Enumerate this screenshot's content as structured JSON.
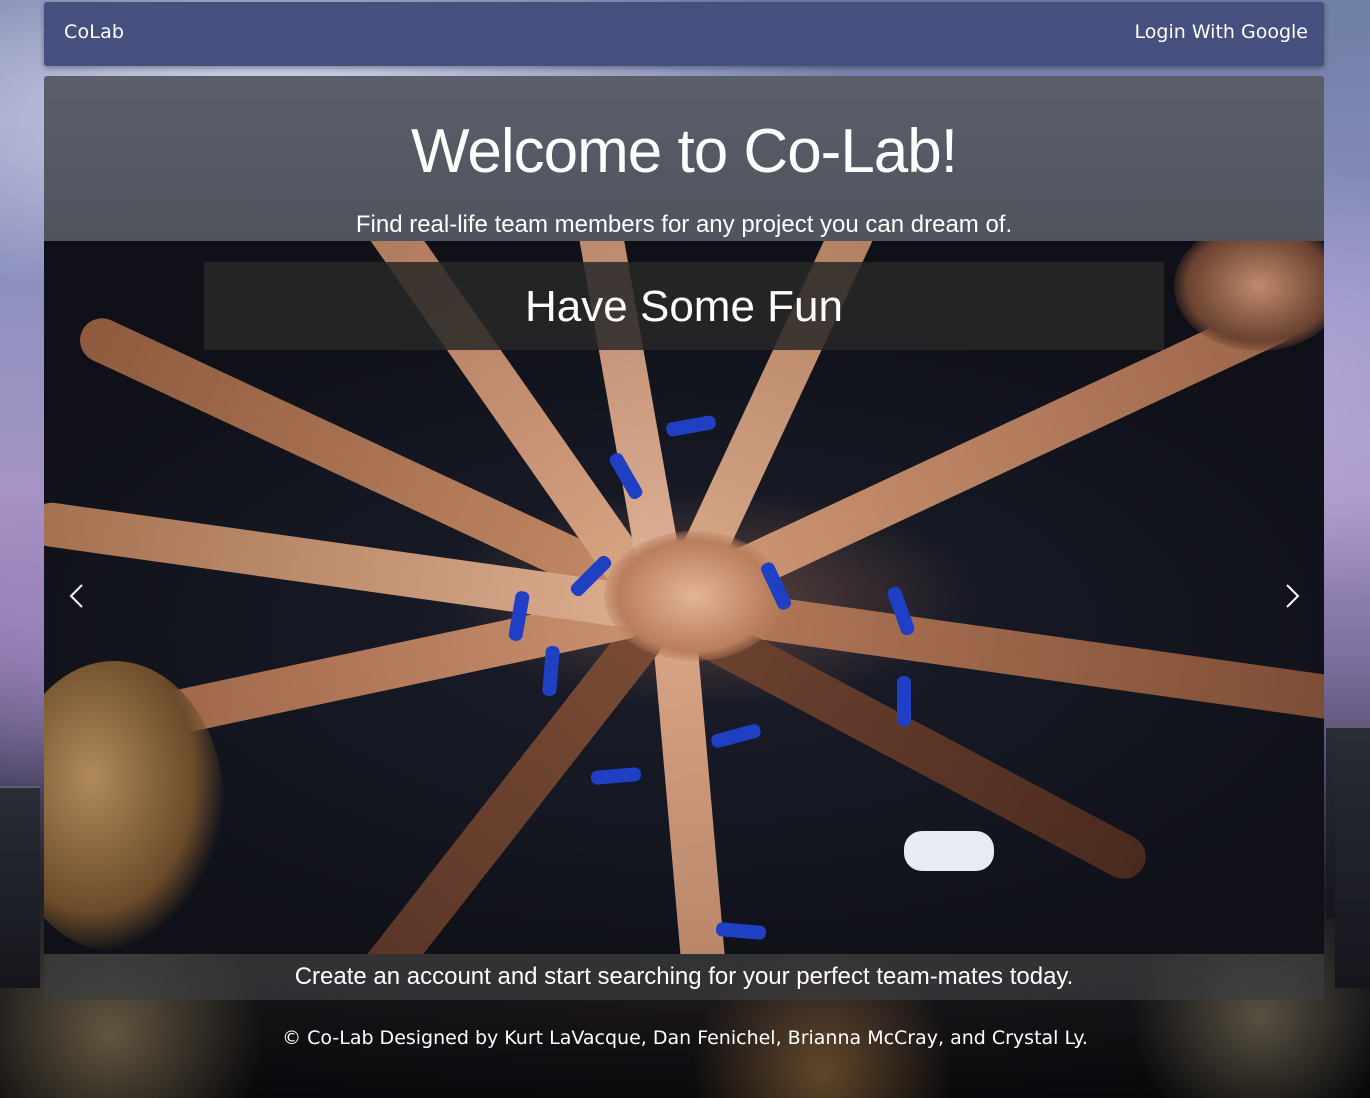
{
  "navbar": {
    "brand": "CoLab",
    "login_label": "Login With Google"
  },
  "jumbotron": {
    "title": "Welcome to Co-Lab!",
    "subtitle": "Find real-life team members for any project you can dream of."
  },
  "carousel": {
    "caption": "Have Some Fun",
    "prev_icon": "chevron-left-icon",
    "next_icon": "chevron-right-icon"
  },
  "cta": {
    "text": "Create an account and start searching for your perfect team-mates today."
  },
  "footer": {
    "copyright": "© Co-Lab Designed by Kurt LaVacque, Dan Fenichel, Brianna McCray, and Crystal Ly."
  },
  "colors": {
    "navbar_bg": "#45507f",
    "jumbotron_bg": "#5b5f6a",
    "band_blue": "#1f3fc4"
  }
}
